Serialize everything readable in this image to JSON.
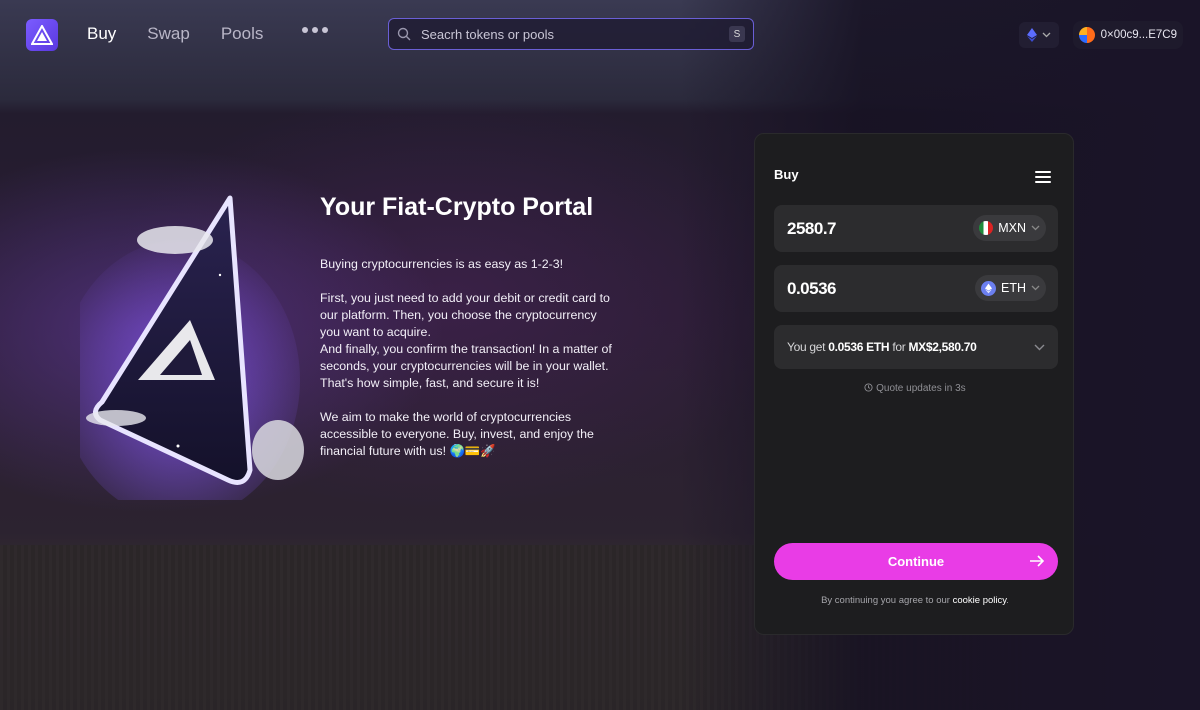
{
  "header": {
    "nav": [
      "Buy",
      "Swap",
      "Pools"
    ],
    "search_placeholder": "Seacrh tokens or pools",
    "search_shortcut": "S",
    "wallet_address": "0×00c9...E7C9"
  },
  "hero": {
    "title": "Your Fiat-Crypto Portal",
    "intro": "Buying cryptocurrencies is as easy as 1-2-3!",
    "steps": "First, you just need to add your debit or credit card to our platform. Then, you choose the cryptocurrency you want to acquire.\nAnd finally, you confirm the transaction! In a matter of seconds, your cryptocurrencies will be in your wallet. That's how simple, fast, and secure it is!",
    "mission": "We aim to make the world of cryptocurrencies accessible to everyone. Buy, invest, and enjoy the financial future with us! 🌍💳🚀"
  },
  "widget": {
    "title": "Buy",
    "fiat_amount": "2580.7",
    "fiat_symbol": "MXN",
    "crypto_amount": "0.0536",
    "crypto_symbol": "ETH",
    "quote_prefix": "You get",
    "quote_crypto": "0.0536 ETH",
    "quote_for": "for",
    "quote_fiat": "MX$2,580.70",
    "quote_update": "Quote updates in 3s",
    "continue_label": "Continue",
    "terms_prefix": "By continuing you agree to our",
    "terms_link": "cookie policy",
    "terms_suffix": "."
  },
  "colors": {
    "accent": "#e93ce6",
    "search_border": "#6a5fd6",
    "logo": "#6b48f0"
  }
}
